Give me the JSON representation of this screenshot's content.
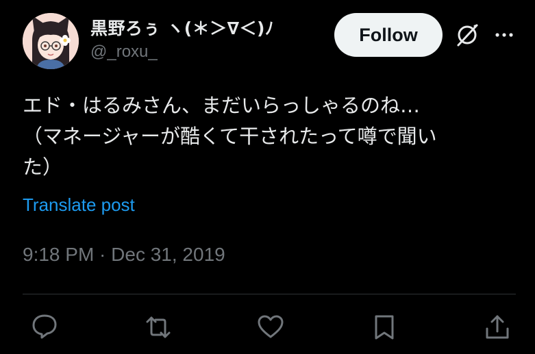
{
  "author": {
    "display_name": "黒野ろぅ ヽ(＊＞∇＜)ﾉ",
    "handle": "@_roxu_",
    "avatar_icon": "avatar-image"
  },
  "header": {
    "follow_label": "Follow",
    "grok_icon": "grok-icon",
    "more_icon": "more-icon"
  },
  "tweet": {
    "lines": [
      "エド・はるみさん、まだいらっしゃるのね…",
      "（マネージャーが酷くて干されたって噂で聞い",
      "た）"
    ],
    "translate_label": "Translate post",
    "timestamp": "9:18 PM · Dec 31, 2019"
  },
  "actions": {
    "icons": [
      "reply-icon",
      "retweet-icon",
      "like-icon",
      "bookmark-icon",
      "share-icon"
    ]
  },
  "colors": {
    "background": "#000000",
    "text_primary": "#e7e9ea",
    "text_secondary": "#71767b",
    "link": "#1d9bf0",
    "follow_bg": "#eff3f4",
    "divider": "#2f3336"
  }
}
